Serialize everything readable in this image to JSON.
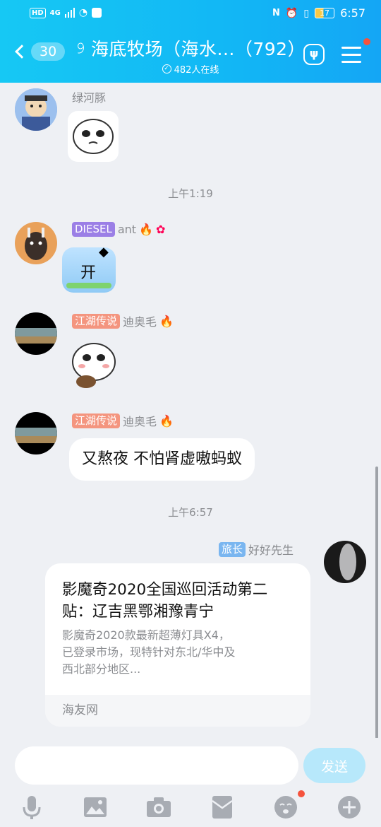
{
  "status_bar": {
    "left_tag": "HD",
    "network": "4G",
    "time": "6:57",
    "battery": "17"
  },
  "header": {
    "back_count": "30",
    "title": "海底牧场（海水...（792）",
    "online_text": "482人在线"
  },
  "messages": {
    "m1": {
      "sender": "绿河豚"
    },
    "time1": "上午1:19",
    "m2": {
      "badge": "DIESEL",
      "badge_color": "#9b7fe6",
      "sender": "ant",
      "text": "开"
    },
    "m3": {
      "badge": "江湖传说",
      "badge_color": "#f4957f",
      "sender": "迪奥毛"
    },
    "m4": {
      "badge": "江湖传说",
      "badge_color": "#f4957f",
      "sender": "迪奥毛",
      "text": "又熬夜 不怕肾虚嗷蚂蚁"
    },
    "time2": "上午6:57",
    "m5": {
      "badge": "旅长",
      "badge_color": "#7ab6f0",
      "sender": "好好先生",
      "card_title": "影魔奇2020全国巡回活动第二贴：辽吉黑鄂湘豫青宁",
      "card_desc": "影魔奇2020款最新超薄灯具X4，已登录市场，现特针对东北/华中及西北部分地区...",
      "card_source": "海友网"
    }
  },
  "input": {
    "placeholder": "",
    "send_label": "发送"
  },
  "colors": {
    "header_start": "#16c8f4",
    "header_end": "#14a6f5",
    "accent": "#12b7f5",
    "send_disabled": "#b7e8fb"
  }
}
